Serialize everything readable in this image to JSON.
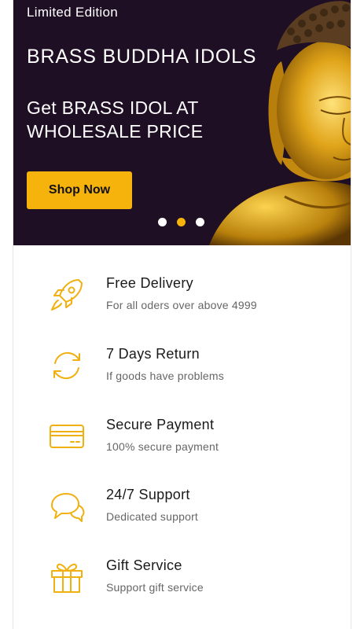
{
  "hero": {
    "eyebrow": "Limited Edition",
    "title": "BRASS BUDDHA IDOLS",
    "subtitle": "Get BRASS IDOL AT WHOLESALE PRICE",
    "cta_label": "Shop Now",
    "background_color": "#1f0f24",
    "accent_color": "#f6b30c",
    "carousel": {
      "slide_count": 3,
      "active_index": 1
    }
  },
  "features": [
    {
      "icon": "rocket-icon",
      "title": "Free Delivery",
      "subtitle": "For all oders over above 4999"
    },
    {
      "icon": "refresh-icon",
      "title": "7 Days Return",
      "subtitle": "If goods have problems"
    },
    {
      "icon": "credit-card-icon",
      "title": "Secure Payment",
      "subtitle": "100% secure payment"
    },
    {
      "icon": "chat-bubbles-icon",
      "title": "24/7 Support",
      "subtitle": "Dedicated support"
    },
    {
      "icon": "gift-icon",
      "title": "Gift Service",
      "subtitle": "Support gift service"
    }
  ]
}
